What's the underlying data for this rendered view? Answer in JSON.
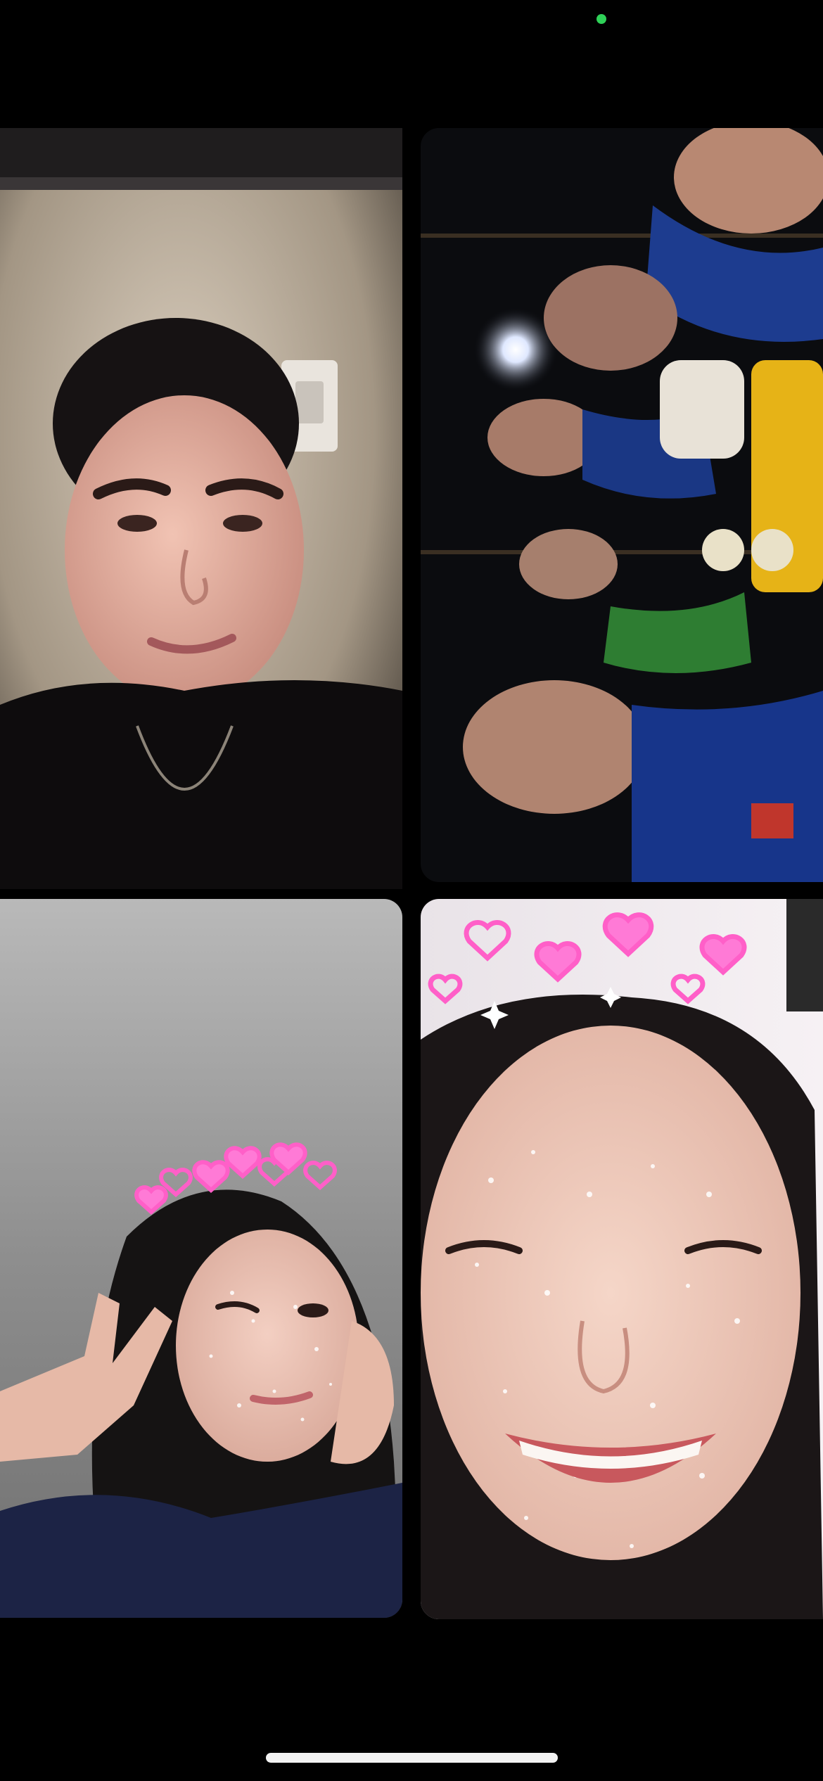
{
  "call": {
    "participant_count": 4,
    "participants": [
      {
        "id": "participant-1",
        "video": "on",
        "filter": "none"
      },
      {
        "id": "participant-2",
        "video": "on",
        "filter": "none"
      },
      {
        "id": "participant-3",
        "video": "on",
        "filter": "hearts-crown"
      },
      {
        "id": "participant-4",
        "video": "on",
        "filter": "hearts-crown"
      }
    ]
  },
  "status_bar": {
    "indicator_color": "#2fd158",
    "indicator_icon": "camera-in-use-dot-icon"
  },
  "colors": {
    "background": "#000000",
    "home_indicator": "#f2f2f2",
    "filter_heart": "#ff5fc8"
  }
}
